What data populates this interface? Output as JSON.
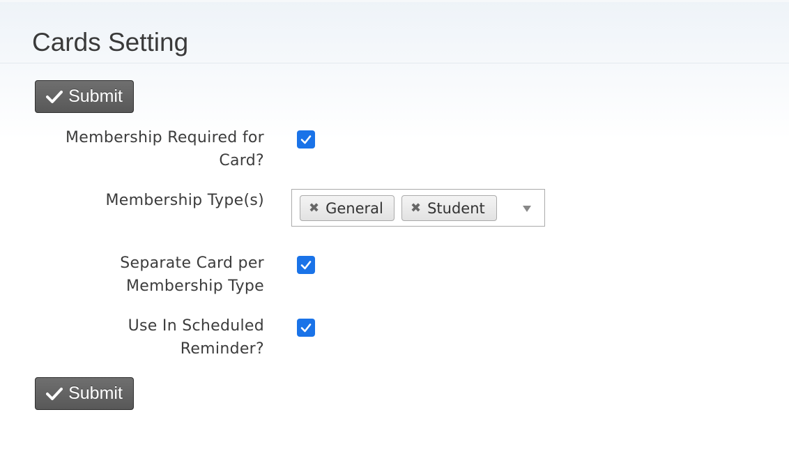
{
  "page": {
    "title": "Cards Setting"
  },
  "buttons": {
    "submit_label": "Submit"
  },
  "fields": {
    "membership_required": {
      "label_line1": "Membership Required for",
      "label_line2": "Card?",
      "checked": true
    },
    "membership_types": {
      "label": "Membership Type(s)",
      "selected": [
        "General",
        "Student"
      ],
      "remove_glyph": "✖"
    },
    "separate_card": {
      "label_line1": "Separate Card per",
      "label_line2": "Membership Type",
      "checked": true
    },
    "scheduled_reminder": {
      "label_line1": "Use In Scheduled",
      "label_line2": "Reminder?",
      "checked": true
    }
  },
  "colors": {
    "checkbox_accent": "#1a73e8",
    "button_bg": "#616161"
  },
  "icons": {
    "submit": "check-icon",
    "checkbox": "checkmark-icon",
    "tag_remove": "remove-icon",
    "dropdown": "chevron-down-icon"
  }
}
